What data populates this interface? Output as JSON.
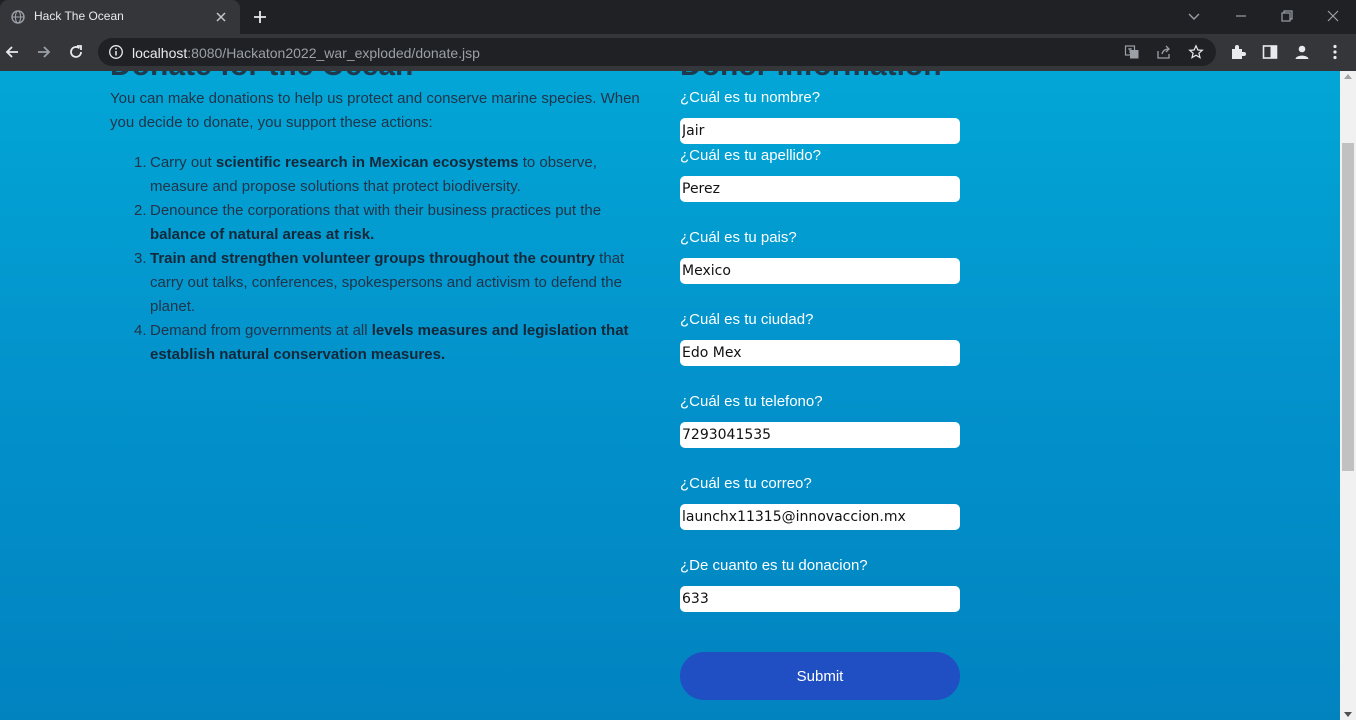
{
  "browser": {
    "tab_title": "Hack The Ocean",
    "url_host": "localhost",
    "url_rest": ":8080/Hackaton2022_war_exploded/donate.jsp",
    "icons": [
      "globe-icon",
      "close-icon",
      "plus-icon",
      "chevron-down-icon",
      "minimize-icon",
      "restore-icon",
      "window-close-icon",
      "back-icon",
      "forward-icon",
      "reload-icon",
      "info-icon",
      "translate-icon",
      "share-icon",
      "star-icon",
      "extensions-icon",
      "side-panel-icon",
      "profile-icon",
      "menu-icon"
    ]
  },
  "page": {
    "left_heading": "Donate for the Ocean",
    "right_heading": "Donor information",
    "intro": "You can make donations to help us protect and conserve marine species. When you decide to donate, you support these actions:",
    "actions": [
      {
        "num": "1.",
        "a": "Carry out ",
        "b": "scientific research in Mexican ecosystems",
        "c": " to observe, measure and propose solutions that protect biodiversity."
      },
      {
        "num": "2.",
        "a": "Denounce the corporations that with their business practices put the ",
        "b": "balance of natural areas at risk.",
        "c": ""
      },
      {
        "num": "3.",
        "a": "",
        "b": "Train and strengthen volunteer groups throughout the country",
        "c": " that carry out talks, conferences, spokespersons and activism to defend the planet."
      },
      {
        "num": "4.",
        "a": "Demand from governments at all ",
        "b": "levels measures and legislation that establish natural conservation measures.",
        "c": ""
      }
    ]
  },
  "form": {
    "fields": [
      {
        "label": "¿Cuál es tu nombre?",
        "value": "Jair"
      },
      {
        "label": "¿Cuál es tu apellido?",
        "value": "Perez"
      },
      {
        "label": "¿Cuál es tu pais?",
        "value": "Mexico"
      },
      {
        "label": "¿Cuál es tu ciudad?",
        "value": "Edo Mex"
      },
      {
        "label": "¿Cuál es tu telefono?",
        "value": "7293041535"
      },
      {
        "label": "¿Cuál es tu correo?",
        "value": "launchx11315@innovaccion.mx"
      },
      {
        "label": "¿De cuanto es tu donacion?",
        "value": "633"
      }
    ],
    "submit_label": "Submit"
  },
  "colors": {
    "page_top": "#02a6d6",
    "page_bottom": "#0183c0",
    "submit_bg": "#204fc3",
    "body_text": "#1f3448"
  }
}
